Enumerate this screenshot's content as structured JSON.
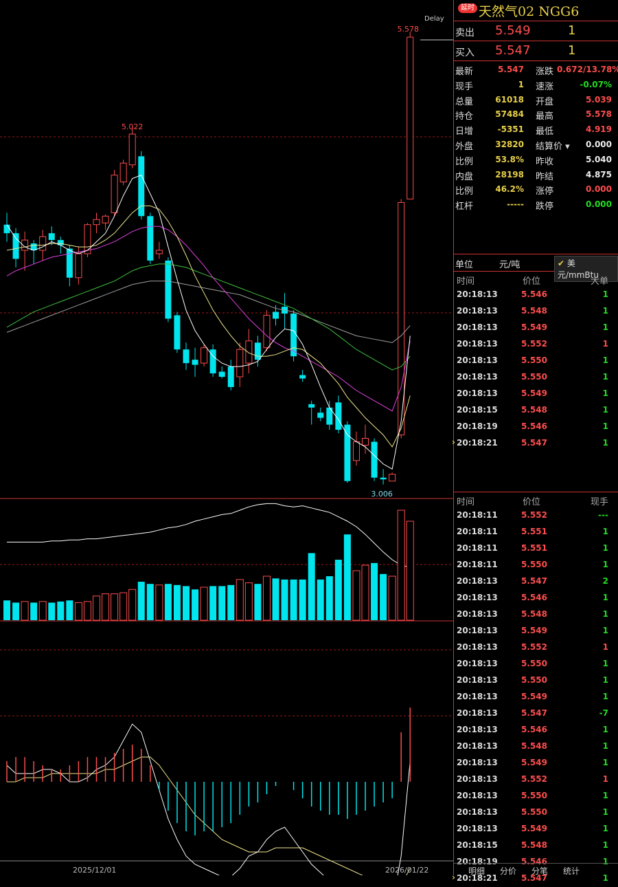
{
  "title": {
    "badge": "延时",
    "name": "天然气02 NGG6"
  },
  "delay_label": "Delay",
  "quote": {
    "ask": {
      "label": "卖出",
      "price": "5.549",
      "volume": "1"
    },
    "bid": {
      "label": "买入",
      "price": "5.547",
      "volume": "1"
    }
  },
  "stats": [
    {
      "l1": "最新",
      "v1": "5.547",
      "c1": "red",
      "l2": "涨跌",
      "v2": "0.672/13.78%",
      "c2": "red"
    },
    {
      "l1": "现手",
      "v1": "1",
      "c1": "yellow",
      "l2": "速涨",
      "v2": "-0.07%",
      "c2": "green"
    },
    {
      "l1": "总量",
      "v1": "61018",
      "c1": "yellow",
      "l2": "开盘",
      "v2": "5.039",
      "c2": "red"
    },
    {
      "l1": "持仓",
      "v1": "57484",
      "c1": "yellow",
      "l2": "最高",
      "v2": "5.578",
      "c2": "red"
    },
    {
      "l1": "日增",
      "v1": "-5351",
      "c1": "yellow",
      "l2": "最低",
      "v2": "4.919",
      "c2": "red"
    },
    {
      "l1": "外盘",
      "v1": "32820",
      "c1": "yellow",
      "l2": "结算价 ▾",
      "v2": "0.000",
      "c2": "white"
    },
    {
      "l1": "比例",
      "v1": "53.8%",
      "c1": "yellow",
      "l2": "昨收",
      "v2": "5.040",
      "c2": "white"
    },
    {
      "l1": "内盘",
      "v1": "28198",
      "c1": "yellow",
      "l2": "昨结",
      "v2": "4.875",
      "c2": "white"
    },
    {
      "l1": "比例",
      "v1": "46.2%",
      "c1": "yellow",
      "l2": "涨停",
      "v2": "0.000",
      "c2": "red"
    },
    {
      "l1": "杠杆",
      "v1": "-----",
      "c1": "yellow",
      "l2": "跌停",
      "v2": "0.000",
      "c2": "green"
    }
  ],
  "units": {
    "label": "单位",
    "opt1": "元/吨",
    "opt2": "美元/mmBtu",
    "check": "✔"
  },
  "big_ticks": {
    "headers": [
      "时间",
      "价位",
      "大单"
    ],
    "rows": [
      {
        "t": "20:18:13",
        "p": "5.546",
        "v": "1",
        "c": "green"
      },
      {
        "t": "20:18:13",
        "p": "5.548",
        "v": "1",
        "c": "green"
      },
      {
        "t": "20:18:13",
        "p": "5.549",
        "v": "1",
        "c": "green"
      },
      {
        "t": "20:18:13",
        "p": "5.552",
        "v": "1",
        "c": "red"
      },
      {
        "t": "20:18:13",
        "p": "5.550",
        "v": "1",
        "c": "green"
      },
      {
        "t": "20:18:13",
        "p": "5.550",
        "v": "1",
        "c": "green"
      },
      {
        "t": "20:18:13",
        "p": "5.549",
        "v": "1",
        "c": "green"
      },
      {
        "t": "20:18:15",
        "p": "5.548",
        "v": "1",
        "c": "green"
      },
      {
        "t": "20:18:19",
        "p": "5.546",
        "v": "1",
        "c": "green"
      },
      {
        "t": "20:18:21",
        "p": "5.547",
        "v": "1",
        "c": "green",
        "marker": "›"
      }
    ]
  },
  "ticks": {
    "headers": [
      "时间",
      "价位",
      "现手"
    ],
    "rows": [
      {
        "t": "20:18:11",
        "p": "5.552",
        "v": "---",
        "c": "green"
      },
      {
        "t": "20:18:11",
        "p": "5.551",
        "v": "1",
        "c": "green"
      },
      {
        "t": "20:18:11",
        "p": "5.551",
        "v": "1",
        "c": "green"
      },
      {
        "t": "20:18:11",
        "p": "5.550",
        "v": "1",
        "c": "green"
      },
      {
        "t": "20:18:13",
        "p": "5.547",
        "v": "2",
        "c": "green"
      },
      {
        "t": "20:18:13",
        "p": "5.546",
        "v": "1",
        "c": "green"
      },
      {
        "t": "20:18:13",
        "p": "5.548",
        "v": "1",
        "c": "green"
      },
      {
        "t": "20:18:13",
        "p": "5.549",
        "v": "1",
        "c": "green"
      },
      {
        "t": "20:18:13",
        "p": "5.552",
        "v": "1",
        "c": "red"
      },
      {
        "t": "20:18:13",
        "p": "5.550",
        "v": "1",
        "c": "green"
      },
      {
        "t": "20:18:13",
        "p": "5.550",
        "v": "1",
        "c": "green"
      },
      {
        "t": "20:18:13",
        "p": "5.549",
        "v": "1",
        "c": "green"
      },
      {
        "t": "20:18:13",
        "p": "5.547",
        "v": "-7",
        "c": "green"
      },
      {
        "t": "20:18:13",
        "p": "5.546",
        "v": "1",
        "c": "green"
      },
      {
        "t": "20:18:13",
        "p": "5.548",
        "v": "1",
        "c": "green"
      },
      {
        "t": "20:18:13",
        "p": "5.549",
        "v": "1",
        "c": "green"
      },
      {
        "t": "20:18:13",
        "p": "5.552",
        "v": "1",
        "c": "red"
      },
      {
        "t": "20:18:13",
        "p": "5.550",
        "v": "1",
        "c": "green"
      },
      {
        "t": "20:18:13",
        "p": "5.550",
        "v": "1",
        "c": "green"
      },
      {
        "t": "20:18:13",
        "p": "5.549",
        "v": "1",
        "c": "green"
      },
      {
        "t": "20:18:15",
        "p": "5.548",
        "v": "1",
        "c": "green"
      },
      {
        "t": "20:18:19",
        "p": "5.546",
        "v": "1",
        "c": "green"
      },
      {
        "t": "20:18:21",
        "p": "5.547",
        "v": "1",
        "c": "green",
        "marker": "›"
      }
    ]
  },
  "tabs": [
    "明细",
    "分价",
    "分笔",
    "统计"
  ],
  "colors": {
    "up": "#ff4d4d",
    "down": "#00e5ee",
    "grid": "#a01818",
    "ma5": "#ffffff",
    "ma10": "#f0e68c",
    "ma20": "#e040e0",
    "ma40": "#40c040",
    "ma60": "#a0a0a0",
    "vol_ma": "#ffffff",
    "dif": "#ffffff",
    "dea": "#f0e68c"
  },
  "chart_data": {
    "type": "candlestick",
    "high_label": "5.022",
    "low_label": "3.006",
    "last_high_label": "5.578",
    "x_tick_labels": [
      "2025/12/01",
      "2026/01/22"
    ],
    "ohlc": [
      [
        4.45,
        4.52,
        4.35,
        4.4
      ],
      [
        4.4,
        4.43,
        4.2,
        4.25
      ],
      [
        4.3,
        4.41,
        4.18,
        4.36
      ],
      [
        4.34,
        4.36,
        4.22,
        4.3
      ],
      [
        4.3,
        4.42,
        4.24,
        4.38
      ],
      [
        4.4,
        4.44,
        4.33,
        4.36
      ],
      [
        4.36,
        4.38,
        4.28,
        4.33
      ],
      [
        4.31,
        4.33,
        4.09,
        4.14
      ],
      [
        4.14,
        4.32,
        4.1,
        4.28
      ],
      [
        4.28,
        4.46,
        4.26,
        4.45
      ],
      [
        4.45,
        4.52,
        4.4,
        4.48
      ],
      [
        4.46,
        4.51,
        4.42,
        4.5
      ],
      [
        4.52,
        4.77,
        4.5,
        4.74
      ],
      [
        4.7,
        4.83,
        4.68,
        4.81
      ],
      [
        4.8,
        5.022,
        4.78,
        4.98
      ],
      [
        4.85,
        4.88,
        4.48,
        4.5
      ],
      [
        4.5,
        4.52,
        4.22,
        4.24
      ],
      [
        4.28,
        4.35,
        4.25,
        4.3
      ],
      [
        4.24,
        4.26,
        3.88,
        3.9
      ],
      [
        3.92,
        3.94,
        3.7,
        3.72
      ],
      [
        3.72,
        3.76,
        3.6,
        3.64
      ],
      [
        3.66,
        3.73,
        3.56,
        3.63
      ],
      [
        3.64,
        3.75,
        3.62,
        3.73
      ],
      [
        3.72,
        3.75,
        3.56,
        3.58
      ],
      [
        3.59,
        3.62,
        3.55,
        3.56
      ],
      [
        3.62,
        3.66,
        3.48,
        3.5
      ],
      [
        3.56,
        3.76,
        3.5,
        3.72
      ],
      [
        3.64,
        3.84,
        3.58,
        3.77
      ],
      [
        3.76,
        3.8,
        3.62,
        3.66
      ],
      [
        3.73,
        3.95,
        3.71,
        3.92
      ],
      [
        3.94,
        3.98,
        3.86,
        3.9
      ],
      [
        3.97,
        4.05,
        3.84,
        3.93
      ],
      [
        3.93,
        3.95,
        3.65,
        3.68
      ],
      [
        3.57,
        3.6,
        3.53,
        3.55
      ],
      [
        3.4,
        3.42,
        3.28,
        3.38
      ],
      [
        3.35,
        3.38,
        3.3,
        3.32
      ],
      [
        3.38,
        3.42,
        3.25,
        3.28
      ],
      [
        3.41,
        3.45,
        3.23,
        3.25
      ],
      [
        3.28,
        3.3,
        2.94,
        2.95
      ],
      [
        3.07,
        3.24,
        3.04,
        3.18
      ],
      [
        3.16,
        3.28,
        3.11,
        3.2
      ],
      [
        3.18,
        3.2,
        2.95,
        2.97
      ],
      [
        2.97,
        3.02,
        2.93,
        2.96
      ],
      [
        2.95,
        3.0,
        3.006,
        2.99
      ],
      [
        3.22,
        4.6,
        3.2,
        4.58
      ],
      [
        4.6,
        5.578,
        4.65,
        5.547
      ]
    ],
    "ma": {
      "ma5": [
        4.45,
        4.37,
        4.32,
        4.3,
        4.32,
        4.35,
        4.33,
        4.3,
        4.28,
        4.3,
        4.35,
        4.4,
        4.5,
        4.62,
        4.72,
        4.74,
        4.63,
        4.52,
        4.32,
        4.13,
        3.95,
        3.83,
        3.75,
        3.68,
        3.64,
        3.62,
        3.62,
        3.63,
        3.65,
        3.72,
        3.79,
        3.84,
        3.83,
        3.75,
        3.63,
        3.5,
        3.38,
        3.31,
        3.22,
        3.18,
        3.15,
        3.1,
        3.05,
        3.02,
        3.3,
        3.8
      ],
      "ma10": [
        4.3,
        4.31,
        4.32,
        4.33,
        4.33,
        4.34,
        4.34,
        4.33,
        4.32,
        4.32,
        4.33,
        4.36,
        4.4,
        4.46,
        4.52,
        4.56,
        4.56,
        4.54,
        4.47,
        4.38,
        4.27,
        4.15,
        4.05,
        3.95,
        3.87,
        3.8,
        3.74,
        3.7,
        3.68,
        3.68,
        3.69,
        3.71,
        3.73,
        3.72,
        3.68,
        3.64,
        3.58,
        3.52,
        3.44,
        3.38,
        3.32,
        3.27,
        3.22,
        3.15,
        3.26,
        3.45
      ],
      "ma20": [
        4.15,
        4.18,
        4.2,
        4.22,
        4.24,
        4.26,
        4.27,
        4.28,
        4.29,
        4.3,
        4.31,
        4.33,
        4.35,
        4.38,
        4.41,
        4.43,
        4.44,
        4.44,
        4.42,
        4.38,
        4.33,
        4.27,
        4.21,
        4.14,
        4.08,
        4.02,
        3.96,
        3.9,
        3.85,
        3.8,
        3.76,
        3.73,
        3.71,
        3.68,
        3.65,
        3.62,
        3.59,
        3.56,
        3.52,
        3.48,
        3.45,
        3.42,
        3.39,
        3.36,
        3.5,
        3.77
      ],
      "ma40": [
        3.85,
        3.88,
        3.91,
        3.94,
        3.96,
        3.98,
        4.0,
        4.02,
        4.04,
        4.06,
        4.08,
        4.1,
        4.12,
        4.15,
        4.18,
        4.2,
        4.21,
        4.22,
        4.22,
        4.21,
        4.2,
        4.18,
        4.16,
        4.14,
        4.12,
        4.1,
        4.08,
        4.06,
        4.04,
        4.02,
        4.0,
        3.98,
        3.96,
        3.93,
        3.9,
        3.87,
        3.84,
        3.8,
        3.76,
        3.72,
        3.69,
        3.66,
        3.63,
        3.6,
        3.62,
        3.68
      ],
      "ma60": [
        3.82,
        3.84,
        3.86,
        3.88,
        3.9,
        3.92,
        3.94,
        3.96,
        3.98,
        4.0,
        4.02,
        4.04,
        4.06,
        4.08,
        4.1,
        4.11,
        4.12,
        4.12,
        4.12,
        4.11,
        4.1,
        4.09,
        4.08,
        4.07,
        4.06,
        4.05,
        4.04,
        4.02,
        4.0,
        3.98,
        3.96,
        3.95,
        3.94,
        3.92,
        3.9,
        3.88,
        3.86,
        3.84,
        3.82,
        3.8,
        3.79,
        3.78,
        3.77,
        3.76,
        3.8,
        3.86
      ]
    },
    "volume": [
      18,
      16,
      17,
      16,
      17,
      16,
      17,
      18,
      16,
      17,
      22,
      24,
      24,
      25,
      28,
      35,
      33,
      32,
      33,
      32,
      31,
      28,
      30,
      31,
      31,
      32,
      37,
      34,
      33,
      40,
      38,
      37,
      37,
      37,
      61,
      37,
      40,
      55,
      78,
      45,
      50,
      52,
      42,
      40,
      100,
      90
    ],
    "volume_ma": [
      71,
      71,
      71,
      71,
      71,
      72,
      72,
      73,
      73,
      74,
      74,
      75,
      76,
      77,
      78,
      79,
      80,
      82,
      84,
      85,
      87,
      90,
      92,
      94,
      96,
      97,
      100,
      103,
      105,
      106,
      106,
      104,
      103,
      104,
      102,
      100,
      98,
      94,
      90,
      85,
      78,
      70,
      62,
      55,
      50,
      48
    ],
    "macd": {
      "hist": [
        0.05,
        0.06,
        0.06,
        0.05,
        0.04,
        0.03,
        0.03,
        0.04,
        0.05,
        0.06,
        0.06,
        0.06,
        0.07,
        0.08,
        0.09,
        0.08,
        0.04,
        -0.02,
        -0.07,
        -0.1,
        -0.12,
        -0.13,
        -0.12,
        -0.12,
        -0.11,
        -0.1,
        -0.08,
        -0.06,
        -0.05,
        -0.03,
        -0.01,
        0.0,
        -0.02,
        -0.04,
        -0.06,
        -0.07,
        -0.08,
        -0.08,
        -0.09,
        -0.08,
        -0.07,
        -0.06,
        -0.05,
        -0.04,
        0.12,
        0.18
      ],
      "dif": [
        0.04,
        0.02,
        0.02,
        0.02,
        0.03,
        0.03,
        0.02,
        0.0,
        0.0,
        0.01,
        0.03,
        0.04,
        0.06,
        0.1,
        0.14,
        0.12,
        0.05,
        -0.02,
        -0.09,
        -0.14,
        -0.18,
        -0.2,
        -0.21,
        -0.22,
        -0.23,
        -0.23,
        -0.21,
        -0.18,
        -0.17,
        -0.14,
        -0.12,
        -0.11,
        -0.14,
        -0.17,
        -0.2,
        -0.22,
        -0.24,
        -0.25,
        -0.28,
        -0.28,
        -0.28,
        -0.29,
        -0.3,
        -0.3,
        -0.18,
        0.05
      ],
      "dea": [
        0.0,
        0.0,
        0.01,
        0.01,
        0.01,
        0.02,
        0.02,
        0.02,
        0.02,
        0.02,
        0.02,
        0.03,
        0.03,
        0.04,
        0.05,
        0.06,
        0.06,
        0.04,
        0.01,
        -0.02,
        -0.05,
        -0.08,
        -0.1,
        -0.12,
        -0.14,
        -0.15,
        -0.16,
        -0.17,
        -0.17,
        -0.17,
        -0.16,
        -0.16,
        -0.16,
        -0.16,
        -0.17,
        -0.18,
        -0.19,
        -0.2,
        -0.21,
        -0.22,
        -0.23,
        -0.24,
        -0.25,
        -0.26,
        -0.25,
        -0.21
      ]
    }
  }
}
